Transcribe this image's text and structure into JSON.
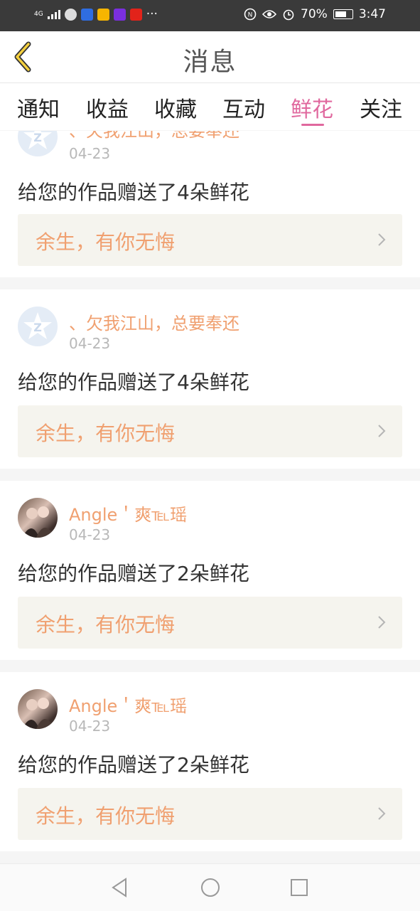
{
  "status_bar": {
    "network": "4G",
    "battery": "70%",
    "time": "3:47",
    "more": "···",
    "icons": [
      "signal-icon",
      "message-icon",
      "baidu-icon",
      "weibo-icon",
      "video-icon",
      "app-icon",
      "nfc-icon",
      "eye-icon",
      "alarm-icon",
      "battery-icon"
    ]
  },
  "header": {
    "title": "消息",
    "back_icon": "back-chevron-icon"
  },
  "tabs": [
    {
      "label": "通知"
    },
    {
      "label": "收益"
    },
    {
      "label": "收藏"
    },
    {
      "label": "互动"
    },
    {
      "label": "鲜花",
      "active": true
    },
    {
      "label": "关注"
    }
  ],
  "accent_color": "#e0689e",
  "name_color": "#f0a070",
  "messages": [
    {
      "user": "、欠我江山，总要奉还",
      "date": "04-23",
      "text": "给您的作品赠送了4朵鲜花",
      "work": "余生，有你无悔",
      "avatar": "default-z-avatar"
    },
    {
      "user": "、欠我江山，总要奉还",
      "date": "04-23",
      "text": "给您的作品赠送了4朵鲜花",
      "work": "余生，有你无悔",
      "avatar": "default-z-avatar"
    },
    {
      "user": "Angle＇爽℡瑶",
      "date": "04-23",
      "text": "给您的作品赠送了2朵鲜花",
      "work": "余生，有你无悔",
      "avatar": "photo-avatar"
    },
    {
      "user": "Angle＇爽℡瑶",
      "date": "04-23",
      "text": "给您的作品赠送了2朵鲜花",
      "work": "余生，有你无悔",
      "avatar": "photo-avatar"
    }
  ],
  "nav": [
    "back-triangle-icon",
    "home-circle-icon",
    "recents-square-icon"
  ]
}
